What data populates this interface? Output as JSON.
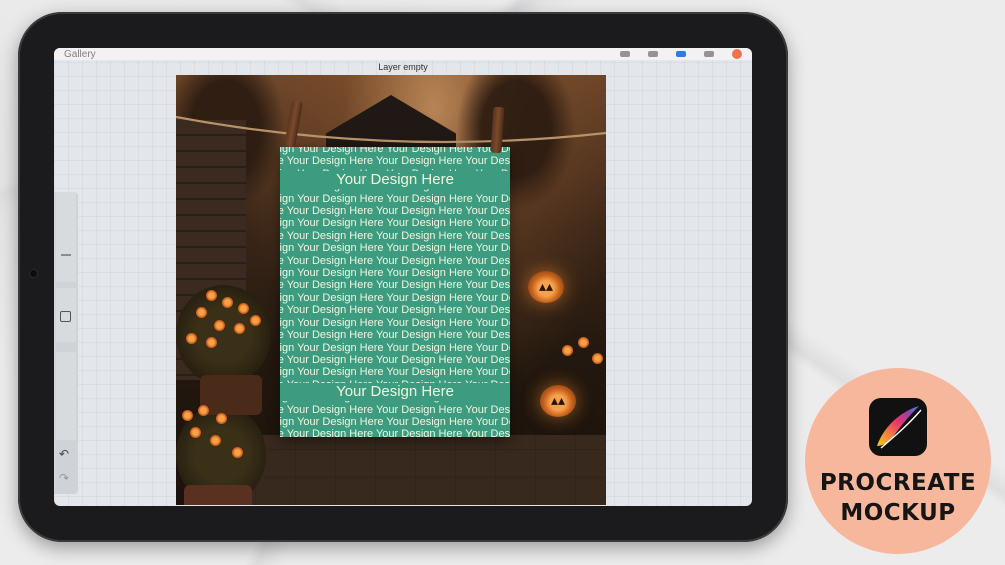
{
  "topbar": {
    "gallery_label": "Gallery"
  },
  "canvas": {
    "layer_status": "Layer empty"
  },
  "mockup": {
    "pattern_text": "Your Design Here",
    "big_text": "Your Design Here",
    "towel_color": "#3d9c80"
  },
  "icons": {
    "undo": "undo-icon",
    "redo": "redo-icon",
    "modify": "square-icon",
    "app": "procreate-icon"
  },
  "badge": {
    "line1": "PROCREATE",
    "line2": "MOCKUP",
    "color": "#f7b79c"
  }
}
